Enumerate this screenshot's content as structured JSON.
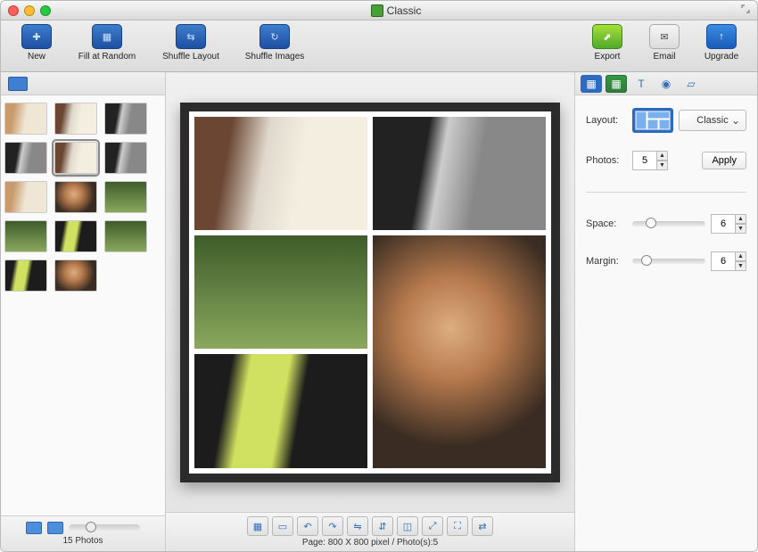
{
  "title": "Classic",
  "toolbar": {
    "new": "New",
    "fill_random": "Fill at Random",
    "shuffle_layout": "Shuffle Layout",
    "shuffle_images": "Shuffle Images",
    "export": "Export",
    "email": "Email",
    "upgrade": "Upgrade"
  },
  "sidebar": {
    "photo_count_label": "15 Photos"
  },
  "canvas": {
    "status": "Page: 800 X 800 pixel / Photo(s):5",
    "tool_icons": [
      "grid",
      "layout",
      "rotate-left",
      "rotate-right",
      "flip-h",
      "flip-v",
      "crop",
      "resize",
      "fit",
      "swap"
    ]
  },
  "panel": {
    "tabs": [
      "layout",
      "grid",
      "text",
      "pattern",
      "color"
    ],
    "layout_label": "Layout:",
    "layout_value": "Classic",
    "photos_label": "Photos:",
    "photos_value": "5",
    "apply_label": "Apply",
    "space_label": "Space:",
    "space_value": "6",
    "margin_label": "Margin:",
    "margin_value": "6"
  }
}
